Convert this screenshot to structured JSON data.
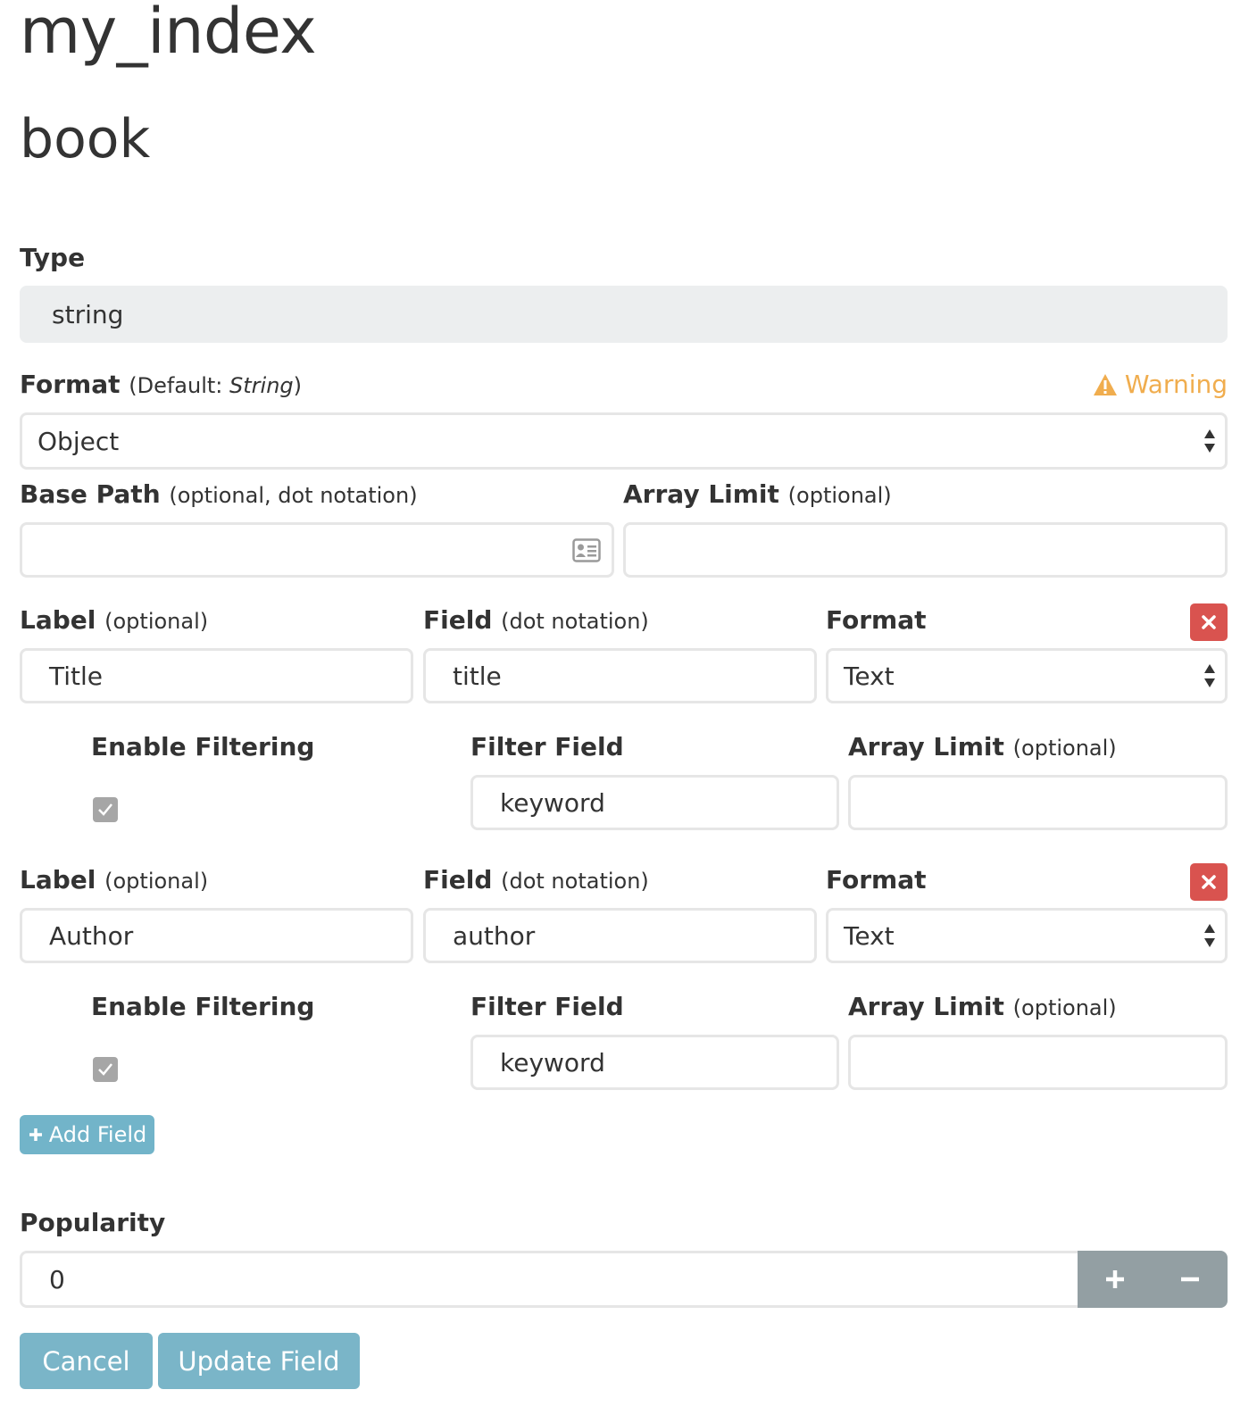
{
  "header": {
    "index_name": "my_index",
    "type_name": "book"
  },
  "type_field": {
    "label": "Type",
    "value": "string"
  },
  "format_field": {
    "label": "Format",
    "default_prefix": "(Default: ",
    "default_value": "String",
    "default_suffix": ")",
    "warning_label": "Warning",
    "selected": "Object",
    "warning_color": "#f0ad4e"
  },
  "base_path": {
    "label": "Base Path",
    "hint": "(optional, dot notation)",
    "value": "",
    "icon": "address-card-icon"
  },
  "array_limit_top": {
    "label": "Array Limit",
    "hint": "(optional)",
    "value": ""
  },
  "fields": [
    {
      "label_label": "Label",
      "label_hint": "(optional)",
      "label_value": "Title",
      "field_label": "Field",
      "field_hint": "(dot notation)",
      "field_value": "title",
      "format_label": "Format",
      "format_value": "Text",
      "enable_filtering_label": "Enable Filtering",
      "enable_filtering": true,
      "filter_field_label": "Filter Field",
      "filter_field_value": "keyword",
      "array_limit_label": "Array Limit",
      "array_limit_hint": "(optional)",
      "array_limit_value": ""
    },
    {
      "label_label": "Label",
      "label_hint": "(optional)",
      "label_value": "Author",
      "field_label": "Field",
      "field_hint": "(dot notation)",
      "field_value": "author",
      "format_label": "Format",
      "format_value": "Text",
      "enable_filtering_label": "Enable Filtering",
      "enable_filtering": true,
      "filter_field_label": "Filter Field",
      "filter_field_value": "keyword",
      "array_limit_label": "Array Limit",
      "array_limit_hint": "(optional)",
      "array_limit_value": ""
    }
  ],
  "add_field_button": "Add Field",
  "popularity": {
    "label": "Popularity",
    "value": "0"
  },
  "actions": {
    "cancel": "Cancel",
    "update": "Update Field"
  },
  "colors": {
    "danger": "#d9534f",
    "info": "#6bb5cc",
    "readonly_bg": "#eceeef",
    "stepper_bg": "#939fa3"
  }
}
